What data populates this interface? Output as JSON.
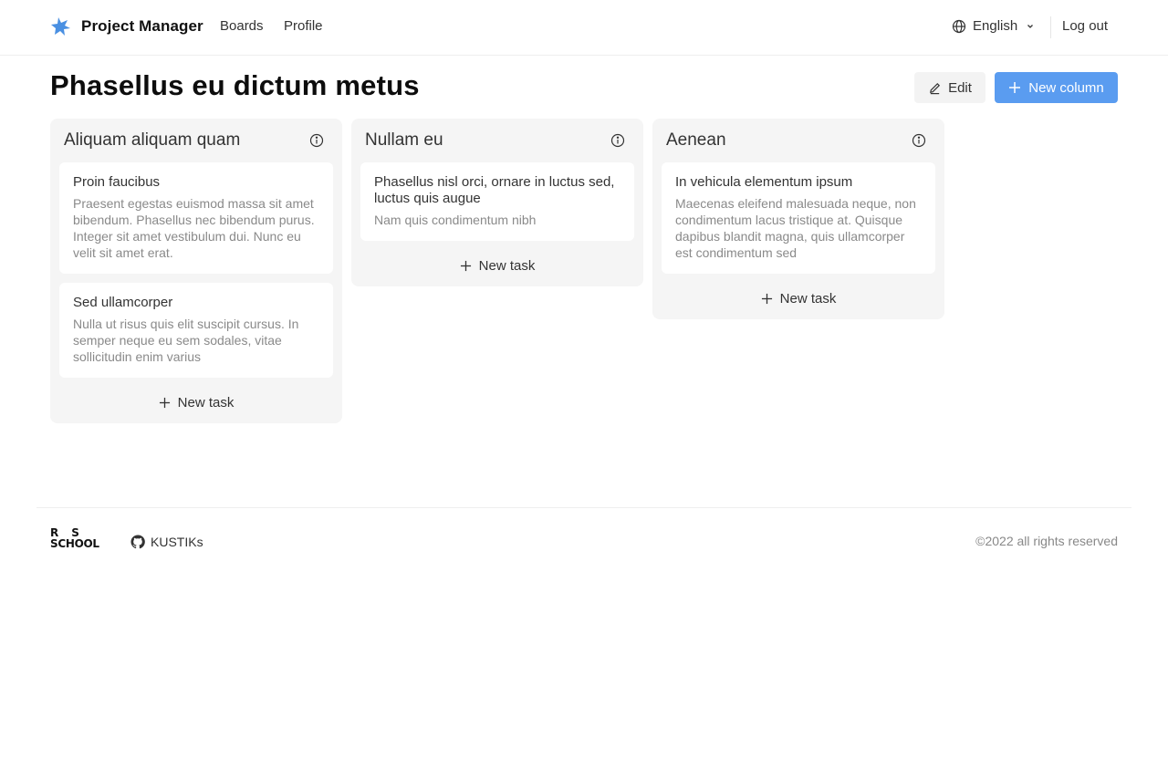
{
  "header": {
    "app_name": "Project Manager",
    "nav": {
      "boards": "Boards",
      "profile": "Profile"
    },
    "language": "English",
    "logout": "Log out",
    "brand_color": "#4a90e2"
  },
  "board": {
    "title": "Phasellus eu dictum metus",
    "edit_label": "Edit",
    "new_column_label": "New column",
    "accent": "#5a9cf0"
  },
  "columns": [
    {
      "title": "Aliquam aliquam quam",
      "tasks": [
        {
          "title": "Proin faucibus",
          "desc": "Praesent egestas euismod massa sit amet bibendum. Phasellus nec bibendum purus. Integer sit amet vestibulum dui. Nunc eu velit sit amet erat."
        },
        {
          "title": "Sed ullamcorper",
          "desc": "Nulla ut risus quis elit suscipit cursus. In semper neque eu sem sodales, vitae sollicitudin enim varius"
        }
      ],
      "new_task": "New task"
    },
    {
      "title": "Nullam eu",
      "tasks": [
        {
          "title": "Phasellus nisl orci, ornare in luctus sed, luctus quis augue",
          "desc": "Nam quis condimentum nibh"
        }
      ],
      "new_task": "New task"
    },
    {
      "title": "Aenean",
      "tasks": [
        {
          "title": "In vehicula elementum ipsum",
          "desc": "Maecenas eleifend malesuada neque, non condimentum lacus tristique at. Quisque dapibus blandit magna, quis ullamcorper est condimentum sed"
        }
      ],
      "new_task": "New task"
    }
  ],
  "footer": {
    "logo_line1": "RS",
    "logo_line2": "SCHOOL",
    "github_user": "KUSTIKs",
    "copyright": "©2022 all rights reserved"
  }
}
